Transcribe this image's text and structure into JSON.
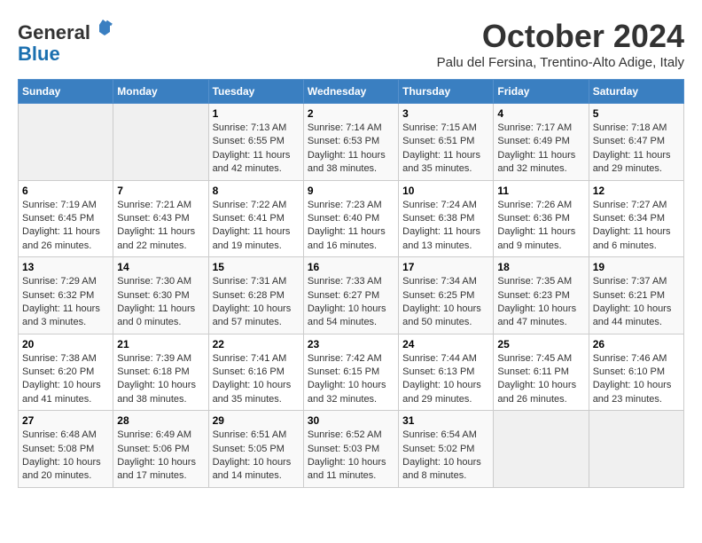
{
  "logo": {
    "line1": "General",
    "line2": "Blue"
  },
  "title": "October 2024",
  "subtitle": "Palu del Fersina, Trentino-Alto Adige, Italy",
  "days_of_week": [
    "Sunday",
    "Monday",
    "Tuesday",
    "Wednesday",
    "Thursday",
    "Friday",
    "Saturday"
  ],
  "weeks": [
    [
      {
        "day": "",
        "sunrise": "",
        "sunset": "",
        "daylight": ""
      },
      {
        "day": "",
        "sunrise": "",
        "sunset": "",
        "daylight": ""
      },
      {
        "day": "1",
        "sunrise": "Sunrise: 7:13 AM",
        "sunset": "Sunset: 6:55 PM",
        "daylight": "Daylight: 11 hours and 42 minutes."
      },
      {
        "day": "2",
        "sunrise": "Sunrise: 7:14 AM",
        "sunset": "Sunset: 6:53 PM",
        "daylight": "Daylight: 11 hours and 38 minutes."
      },
      {
        "day": "3",
        "sunrise": "Sunrise: 7:15 AM",
        "sunset": "Sunset: 6:51 PM",
        "daylight": "Daylight: 11 hours and 35 minutes."
      },
      {
        "day": "4",
        "sunrise": "Sunrise: 7:17 AM",
        "sunset": "Sunset: 6:49 PM",
        "daylight": "Daylight: 11 hours and 32 minutes."
      },
      {
        "day": "5",
        "sunrise": "Sunrise: 7:18 AM",
        "sunset": "Sunset: 6:47 PM",
        "daylight": "Daylight: 11 hours and 29 minutes."
      }
    ],
    [
      {
        "day": "6",
        "sunrise": "Sunrise: 7:19 AM",
        "sunset": "Sunset: 6:45 PM",
        "daylight": "Daylight: 11 hours and 26 minutes."
      },
      {
        "day": "7",
        "sunrise": "Sunrise: 7:21 AM",
        "sunset": "Sunset: 6:43 PM",
        "daylight": "Daylight: 11 hours and 22 minutes."
      },
      {
        "day": "8",
        "sunrise": "Sunrise: 7:22 AM",
        "sunset": "Sunset: 6:41 PM",
        "daylight": "Daylight: 11 hours and 19 minutes."
      },
      {
        "day": "9",
        "sunrise": "Sunrise: 7:23 AM",
        "sunset": "Sunset: 6:40 PM",
        "daylight": "Daylight: 11 hours and 16 minutes."
      },
      {
        "day": "10",
        "sunrise": "Sunrise: 7:24 AM",
        "sunset": "Sunset: 6:38 PM",
        "daylight": "Daylight: 11 hours and 13 minutes."
      },
      {
        "day": "11",
        "sunrise": "Sunrise: 7:26 AM",
        "sunset": "Sunset: 6:36 PM",
        "daylight": "Daylight: 11 hours and 9 minutes."
      },
      {
        "day": "12",
        "sunrise": "Sunrise: 7:27 AM",
        "sunset": "Sunset: 6:34 PM",
        "daylight": "Daylight: 11 hours and 6 minutes."
      }
    ],
    [
      {
        "day": "13",
        "sunrise": "Sunrise: 7:29 AM",
        "sunset": "Sunset: 6:32 PM",
        "daylight": "Daylight: 11 hours and 3 minutes."
      },
      {
        "day": "14",
        "sunrise": "Sunrise: 7:30 AM",
        "sunset": "Sunset: 6:30 PM",
        "daylight": "Daylight: 11 hours and 0 minutes."
      },
      {
        "day": "15",
        "sunrise": "Sunrise: 7:31 AM",
        "sunset": "Sunset: 6:28 PM",
        "daylight": "Daylight: 10 hours and 57 minutes."
      },
      {
        "day": "16",
        "sunrise": "Sunrise: 7:33 AM",
        "sunset": "Sunset: 6:27 PM",
        "daylight": "Daylight: 10 hours and 54 minutes."
      },
      {
        "day": "17",
        "sunrise": "Sunrise: 7:34 AM",
        "sunset": "Sunset: 6:25 PM",
        "daylight": "Daylight: 10 hours and 50 minutes."
      },
      {
        "day": "18",
        "sunrise": "Sunrise: 7:35 AM",
        "sunset": "Sunset: 6:23 PM",
        "daylight": "Daylight: 10 hours and 47 minutes."
      },
      {
        "day": "19",
        "sunrise": "Sunrise: 7:37 AM",
        "sunset": "Sunset: 6:21 PM",
        "daylight": "Daylight: 10 hours and 44 minutes."
      }
    ],
    [
      {
        "day": "20",
        "sunrise": "Sunrise: 7:38 AM",
        "sunset": "Sunset: 6:20 PM",
        "daylight": "Daylight: 10 hours and 41 minutes."
      },
      {
        "day": "21",
        "sunrise": "Sunrise: 7:39 AM",
        "sunset": "Sunset: 6:18 PM",
        "daylight": "Daylight: 10 hours and 38 minutes."
      },
      {
        "day": "22",
        "sunrise": "Sunrise: 7:41 AM",
        "sunset": "Sunset: 6:16 PM",
        "daylight": "Daylight: 10 hours and 35 minutes."
      },
      {
        "day": "23",
        "sunrise": "Sunrise: 7:42 AM",
        "sunset": "Sunset: 6:15 PM",
        "daylight": "Daylight: 10 hours and 32 minutes."
      },
      {
        "day": "24",
        "sunrise": "Sunrise: 7:44 AM",
        "sunset": "Sunset: 6:13 PM",
        "daylight": "Daylight: 10 hours and 29 minutes."
      },
      {
        "day": "25",
        "sunrise": "Sunrise: 7:45 AM",
        "sunset": "Sunset: 6:11 PM",
        "daylight": "Daylight: 10 hours and 26 minutes."
      },
      {
        "day": "26",
        "sunrise": "Sunrise: 7:46 AM",
        "sunset": "Sunset: 6:10 PM",
        "daylight": "Daylight: 10 hours and 23 minutes."
      }
    ],
    [
      {
        "day": "27",
        "sunrise": "Sunrise: 6:48 AM",
        "sunset": "Sunset: 5:08 PM",
        "daylight": "Daylight: 10 hours and 20 minutes."
      },
      {
        "day": "28",
        "sunrise": "Sunrise: 6:49 AM",
        "sunset": "Sunset: 5:06 PM",
        "daylight": "Daylight: 10 hours and 17 minutes."
      },
      {
        "day": "29",
        "sunrise": "Sunrise: 6:51 AM",
        "sunset": "Sunset: 5:05 PM",
        "daylight": "Daylight: 10 hours and 14 minutes."
      },
      {
        "day": "30",
        "sunrise": "Sunrise: 6:52 AM",
        "sunset": "Sunset: 5:03 PM",
        "daylight": "Daylight: 10 hours and 11 minutes."
      },
      {
        "day": "31",
        "sunrise": "Sunrise: 6:54 AM",
        "sunset": "Sunset: 5:02 PM",
        "daylight": "Daylight: 10 hours and 8 minutes."
      },
      {
        "day": "",
        "sunrise": "",
        "sunset": "",
        "daylight": ""
      },
      {
        "day": "",
        "sunrise": "",
        "sunset": "",
        "daylight": ""
      }
    ]
  ]
}
